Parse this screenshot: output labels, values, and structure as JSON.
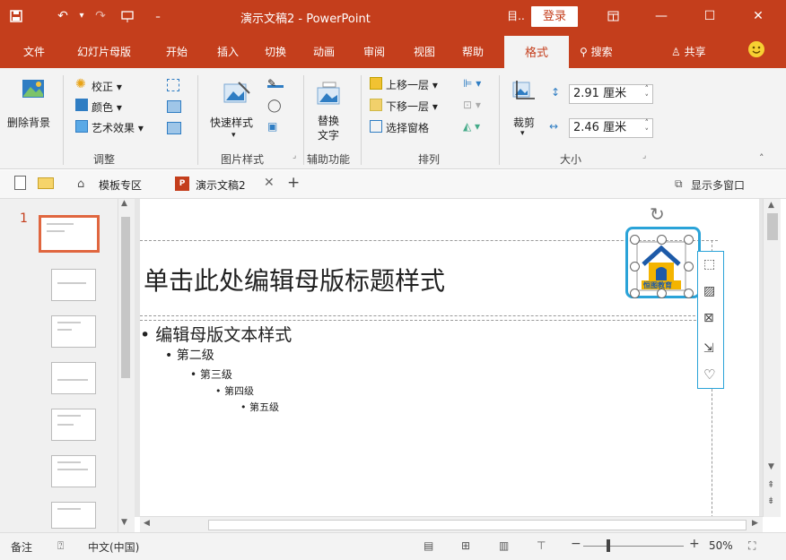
{
  "titlebar": {
    "title": "演示文稿2  -  PowerPoint",
    "login": "登录",
    "share_glyph": "目.."
  },
  "tabs": [
    "文件",
    "幻灯片母版",
    "开始",
    "插入",
    "切换",
    "动画",
    "审阅",
    "视图",
    "帮助"
  ],
  "active_tab": "格式",
  "search": "搜索",
  "share": "共享",
  "ribbon": {
    "remove_bg": "删除背景",
    "adjust": {
      "correction": "校正",
      "color": "颜色",
      "effects": "艺术效果",
      "label": "调整"
    },
    "styles": {
      "quick": "快速样式",
      "label": "图片样式"
    },
    "accessibility": {
      "alt1": "替换",
      "alt2": "文字",
      "label": "辅助功能"
    },
    "arrange": {
      "forward": "上移一层",
      "backward": "下移一层",
      "pane": "选择窗格",
      "label": "排列"
    },
    "size": {
      "crop": "裁剪",
      "height": "2.91 厘米",
      "width": "2.46 厘米",
      "label": "大小"
    }
  },
  "doctabs": {
    "template": "模板专区",
    "doc": "演示文稿2",
    "multi": "显示多窗口"
  },
  "slide": {
    "number": "1",
    "title": "单击此处编辑母版标题样式",
    "levels": [
      "编辑母版文本样式",
      "第二级",
      "第三级",
      "第四级",
      "第五级"
    ],
    "logo_text": "恒图教育"
  },
  "status": {
    "notes": "备注",
    "lang": "中文(中国)",
    "zoom": "50%"
  }
}
